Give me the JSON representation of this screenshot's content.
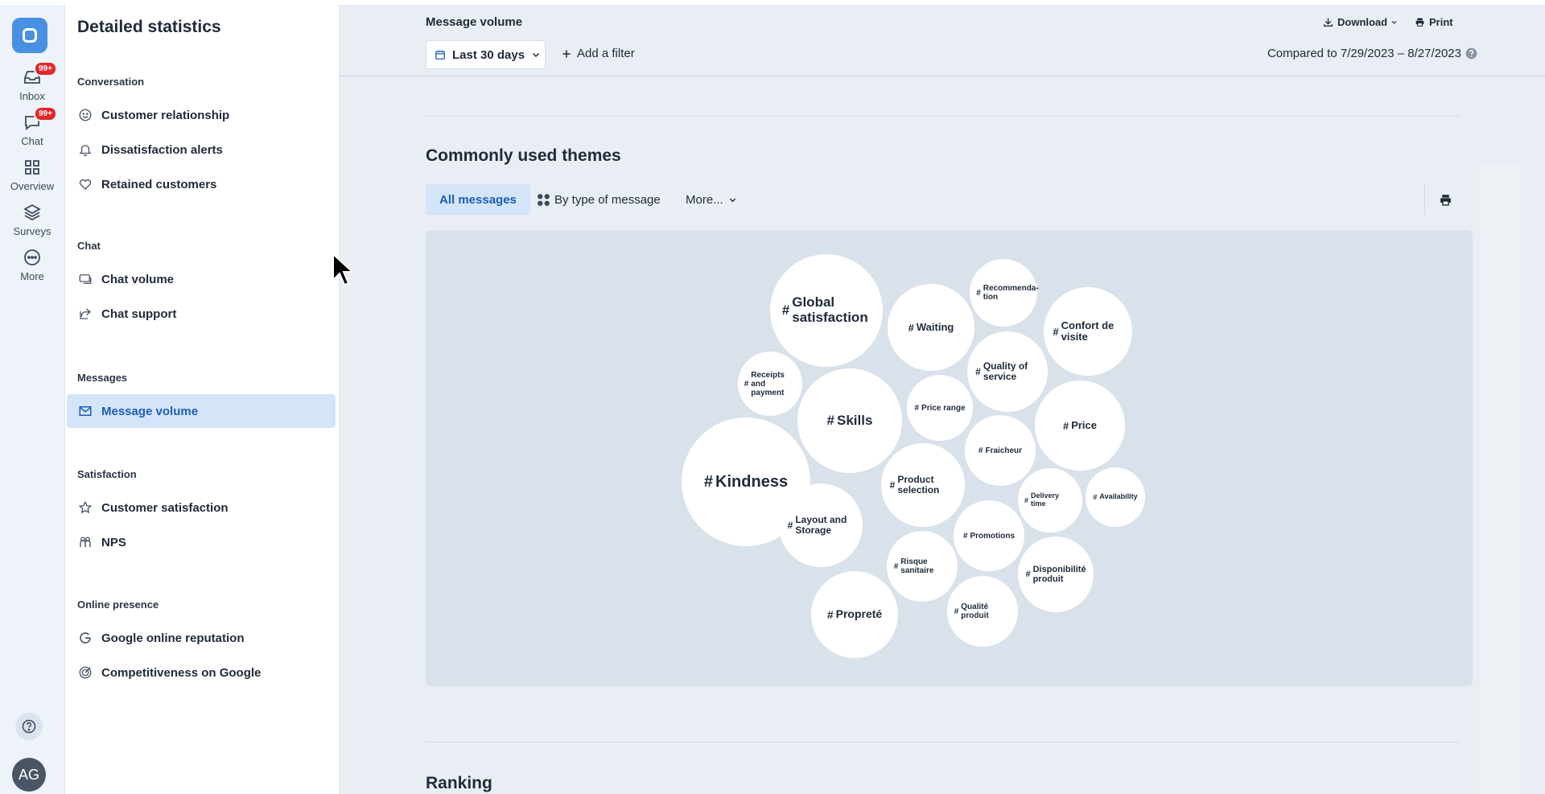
{
  "rail": {
    "items": [
      {
        "label": "Inbox",
        "badge": "99+"
      },
      {
        "label": "Chat",
        "badge": "99+"
      },
      {
        "label": "Overview"
      },
      {
        "label": "Surveys"
      },
      {
        "label": "More"
      }
    ],
    "avatar": "AG"
  },
  "sidebar": {
    "title": "Detailed statistics",
    "sections": [
      {
        "title": "Conversation",
        "items": [
          "Customer relationship",
          "Dissatisfaction alerts",
          "Retained customers"
        ]
      },
      {
        "title": "Chat",
        "items": [
          "Chat volume",
          "Chat support"
        ]
      },
      {
        "title": "Messages",
        "items": [
          "Message volume"
        ]
      },
      {
        "title": "Satisfaction",
        "items": [
          "Customer satisfaction",
          "NPS"
        ]
      },
      {
        "title": "Online presence",
        "items": [
          "Google online reputation",
          "Competitiveness on Google"
        ]
      }
    ],
    "active_item": "Message volume"
  },
  "header": {
    "title": "Message volume",
    "date_range": "Last 30 days",
    "add_filter": "Add a filter",
    "download": "Download",
    "print": "Print",
    "compared": "Compared to 7/29/2023 – 8/27/2023"
  },
  "themes": {
    "title": "Commonly used themes",
    "tabs": [
      "All messages",
      "By type of message",
      "More..."
    ],
    "bubbles": [
      "Global satisfaction",
      "Waiting",
      "Recommenda-tion",
      "Confort de visite",
      "Receipts and payment",
      "Quality of service",
      "Skills",
      "Price range",
      "Price",
      "Kindness",
      "Fraicheur",
      "Product selection",
      "Delivery time",
      "Availability",
      "Layout and Storage",
      "Promotions",
      "Risque sanitaire",
      "Disponibilité produit",
      "Propreté",
      "Qualité produit"
    ]
  },
  "ranking": {
    "title": "Ranking"
  },
  "colors": {
    "accent": "#1f5eb5",
    "active_bg": "#d4e5f9",
    "badge": "#e3262c",
    "logo": "#4a90e2"
  }
}
